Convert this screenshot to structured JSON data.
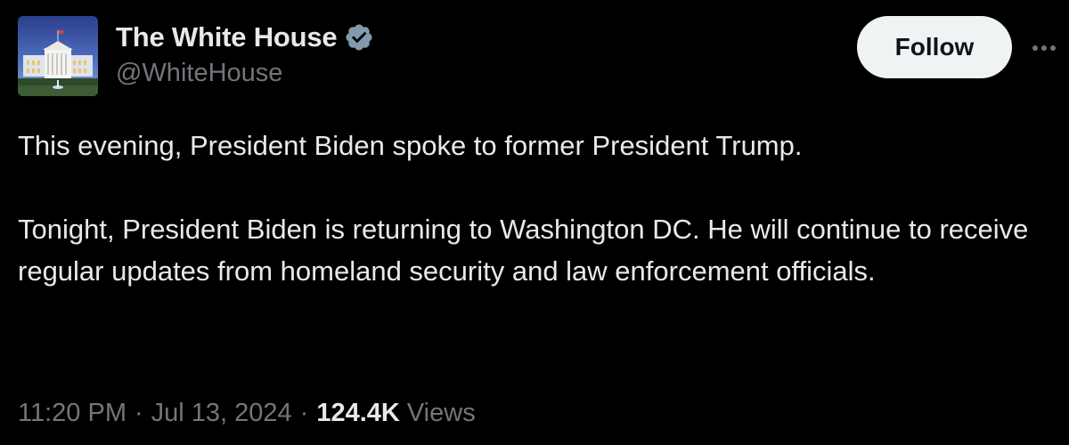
{
  "author": {
    "display_name": "The White House",
    "handle": "@WhiteHouse",
    "verified": true,
    "verified_color": "#829aab"
  },
  "actions": {
    "follow_label": "Follow",
    "more_icon": "more-horizontal-icon"
  },
  "tweet": {
    "paragraphs": [
      "This evening, President Biden spoke to former President Trump.",
      "Tonight, President Biden is returning to Washington DC. He will continue to receive regular updates from homeland security and law enforcement officials."
    ],
    "time": "11:20 PM",
    "date": "Jul 13, 2024",
    "separator": "·",
    "views_count": "124.4K",
    "views_label": "Views"
  },
  "colors": {
    "background": "#000000",
    "text_primary": "#e7e9ea",
    "text_secondary": "#71767b",
    "follow_bg": "#eff3f4",
    "follow_text": "#0f1419"
  }
}
